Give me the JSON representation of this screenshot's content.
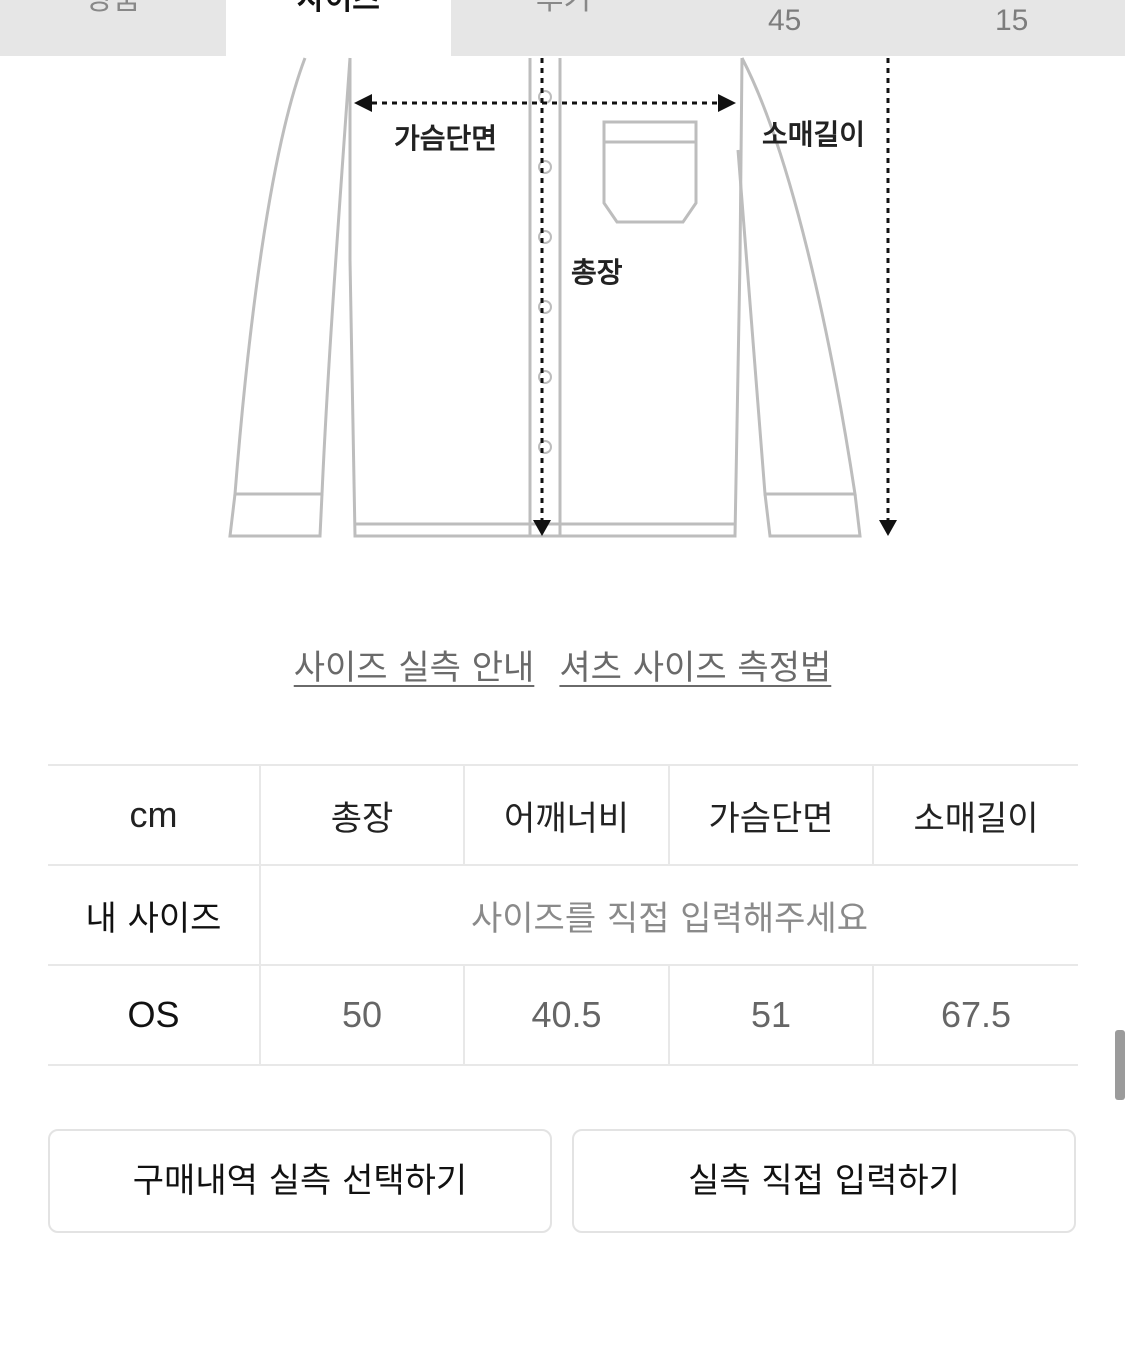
{
  "tabs": [
    {
      "label": "상품",
      "active": false
    },
    {
      "label": "사이즈",
      "active": true
    },
    {
      "label": "후기",
      "active": false
    }
  ],
  "tab_counts": [
    "45",
    "15"
  ],
  "diagram": {
    "chest_label": "가슴단면",
    "sleeve_label": "소매길이",
    "length_label": "총장"
  },
  "links": {
    "size_guide": "사이즈 실측 안내",
    "shirt_measure": "셔츠 사이즈 측정법"
  },
  "table": {
    "unit": "cm",
    "headers": [
      "총장",
      "어깨너비",
      "가슴단면",
      "소매길이"
    ],
    "my_size_label": "내 사이즈",
    "my_size_placeholder": "사이즈를 직접 입력해주세요",
    "rows": [
      {
        "size": "OS",
        "values": [
          "50",
          "40.5",
          "51",
          "67.5"
        ]
      }
    ]
  },
  "buttons": {
    "purchase_history": "구매내역 실측 선택하기",
    "direct_input": "실측 직접 입력하기"
  }
}
